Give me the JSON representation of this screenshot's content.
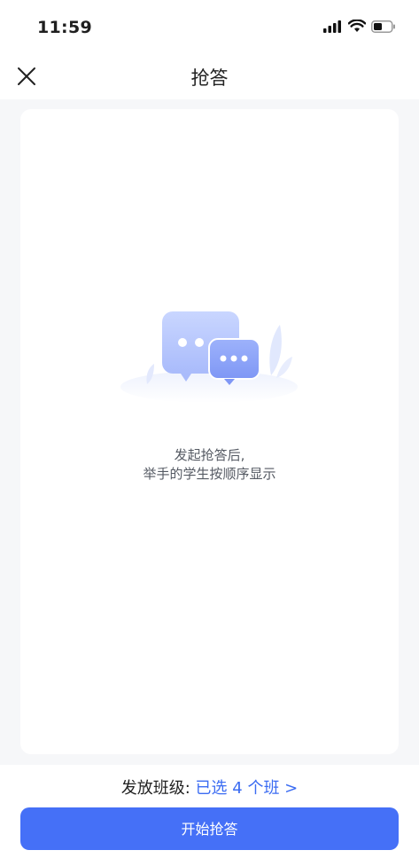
{
  "status_bar": {
    "time": "11:59"
  },
  "nav": {
    "title": "抢答"
  },
  "empty_state": {
    "line1": "发起抢答后,",
    "line2": "举手的学生按顺序显示"
  },
  "bottom": {
    "class_label": "发放班级:",
    "class_selection": "已选 4 个班 >",
    "start_button": "开始抢答"
  },
  "colors": {
    "accent": "#4570f7",
    "link": "#3b6cf2"
  }
}
